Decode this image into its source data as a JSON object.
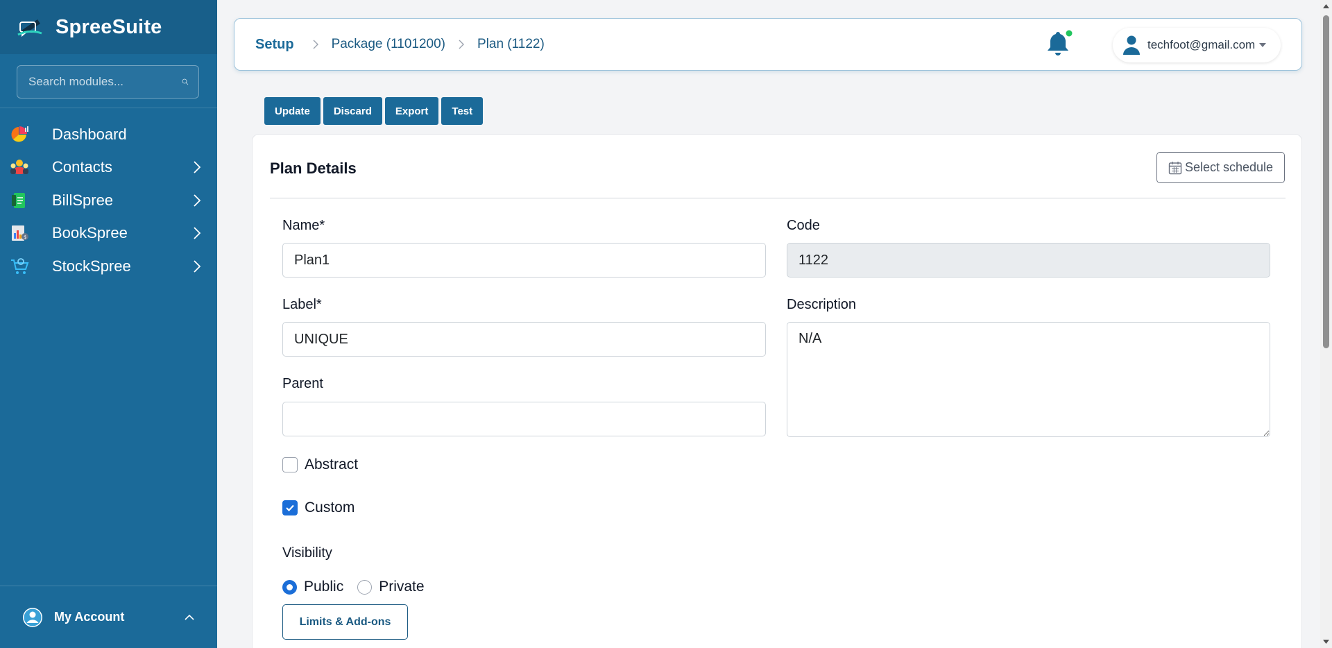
{
  "sidebar": {
    "brand": "SpreeSuite",
    "search_placeholder": "Search modules...",
    "items": [
      {
        "label": "Dashboard",
        "icon": "pie-chart-icon",
        "has_submenu": false
      },
      {
        "label": "Contacts",
        "icon": "contacts-icon",
        "has_submenu": true
      },
      {
        "label": "BillSpree",
        "icon": "bill-icon",
        "has_submenu": true
      },
      {
        "label": "BookSpree",
        "icon": "book-icon",
        "has_submenu": true
      },
      {
        "label": "StockSpree",
        "icon": "stock-cart-icon",
        "has_submenu": true
      }
    ],
    "account_label": "My Account"
  },
  "header": {
    "breadcrumb": [
      "Setup",
      "Package (1101200)",
      "Plan (1122)"
    ],
    "user_email": "techfoot@gmail.com",
    "notification_dot_color": "#22c55e"
  },
  "toolbar": {
    "update": "Update",
    "discard": "Discard",
    "export": "Export",
    "test": "Test"
  },
  "card": {
    "title": "Plan Details",
    "schedule_button": "Select schedule",
    "name_label": "Name*",
    "name_value": "Plan1",
    "code_label": "Code",
    "code_value": "1122",
    "label_label": "Label*",
    "label_value": "UNIQUE",
    "description_label": "Description",
    "description_value": "N/A",
    "parent_label": "Parent",
    "parent_value": "",
    "abstract_label": "Abstract",
    "abstract_checked": false,
    "custom_label": "Custom",
    "custom_checked": true,
    "visibility_label": "Visibility",
    "visibility_public": "Public",
    "visibility_private": "Private",
    "visibility_selected": "Public",
    "limits_button": "Limits & Add-ons"
  },
  "colors": {
    "sidebar_bg": "#1b6a99",
    "accent": "#1b6a99",
    "checkbox_blue": "#1b6ed8"
  }
}
